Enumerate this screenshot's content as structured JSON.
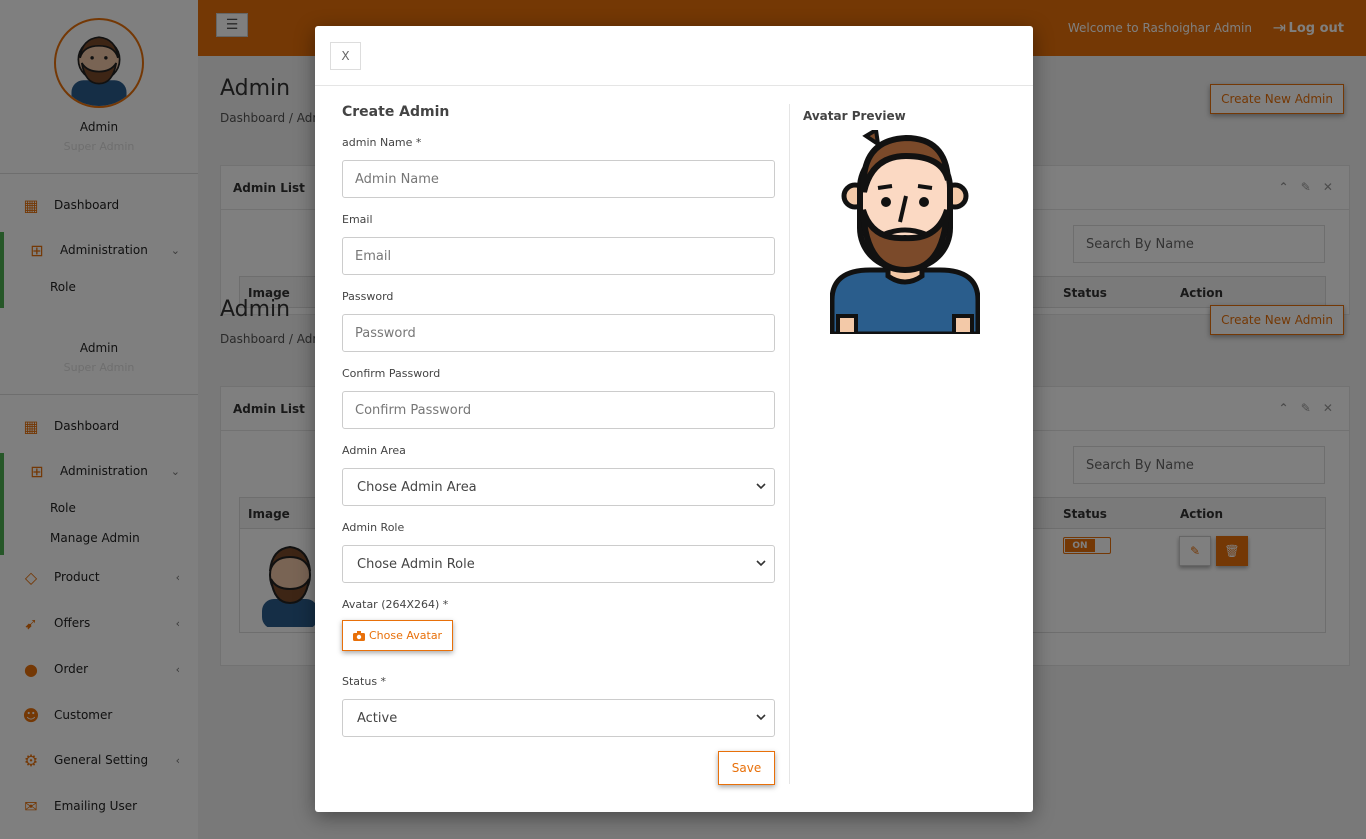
{
  "sidebar": {
    "profile_name": "Admin",
    "profile_role": "Super Admin",
    "items": [
      {
        "label": "Dashboard",
        "icon": "grid-icon"
      },
      {
        "label": "Administration",
        "icon": "sitemap-icon"
      },
      {
        "label": "Role"
      },
      {
        "label": "Manage Admin"
      },
      {
        "label": "Product",
        "icon": "diamond-icon"
      },
      {
        "label": "Offers",
        "icon": "rocket-icon"
      },
      {
        "label": "Order",
        "icon": "circle-icon"
      },
      {
        "label": "Customer",
        "icon": "users-icon"
      },
      {
        "label": "General Setting",
        "icon": "gear-icon"
      },
      {
        "label": "Emailing User",
        "icon": "envelope-icon"
      }
    ],
    "chevron_down": "⌄",
    "chevron_left": "‹"
  },
  "topbar": {
    "menu_icon": "☰",
    "welcome": "Welcome to Rashoighar Admin",
    "logout_icon": "⇥",
    "logout": "Log out"
  },
  "page": {
    "title": "Admin",
    "breadcrumb": "Dashboard  /  Admin",
    "create_button": "Create New Admin",
    "panel_title": "Admin List",
    "panel_tools": "⌃ ✎ ✕",
    "search_placeholder": "Search By Name",
    "columns": {
      "image": "Image",
      "status": "Status",
      "action": "Action"
    },
    "row": {
      "status": "ON",
      "edit_icon": "✎",
      "delete_icon": "🗑"
    }
  },
  "modal": {
    "close": "X",
    "title": "Create Admin",
    "fields": {
      "name_label": "admin Name *",
      "name_placeholder": "Admin Name",
      "email_label": "Email",
      "email_placeholder": "Email",
      "password_label": "Password",
      "password_placeholder": "Password",
      "confirm_label": "Confirm Password",
      "confirm_placeholder": "Confirm Password",
      "area_label": "Admin Area",
      "area_value": "Chose Admin Area",
      "role_label": "Admin Role",
      "role_value": "Chose Admin Role",
      "avatar_label": "Avatar (264X264) *",
      "avatar_button": "Chose Avatar",
      "status_label": "Status *",
      "status_value": "Active"
    },
    "save": "Save",
    "preview_title": "Avatar Preview"
  },
  "colors": {
    "accent": "#e8700a",
    "active_marker": "#4caf50"
  }
}
